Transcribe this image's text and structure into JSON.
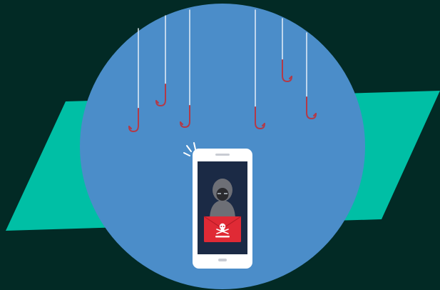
{
  "illustration": {
    "subject": "smishing-phishing-phone",
    "icons": [
      "fish-hook-icon",
      "smartphone-icon",
      "hacker-icon",
      "warning-envelope-icon",
      "skull-crossbones-icon",
      "notification-spark-icon"
    ]
  },
  "colors": {
    "background": "#022a25",
    "parallelogram": "#00bfa5",
    "circle": "#4b8dc9",
    "fishing_line": "#e6eef7",
    "hook": "#b23a48",
    "phone_body": "#ffffff",
    "phone_screen": "#1b2a45",
    "hacker_hood": "#6d6f76",
    "hacker_face": "#2a2a2e",
    "envelope": "#e02a35"
  }
}
